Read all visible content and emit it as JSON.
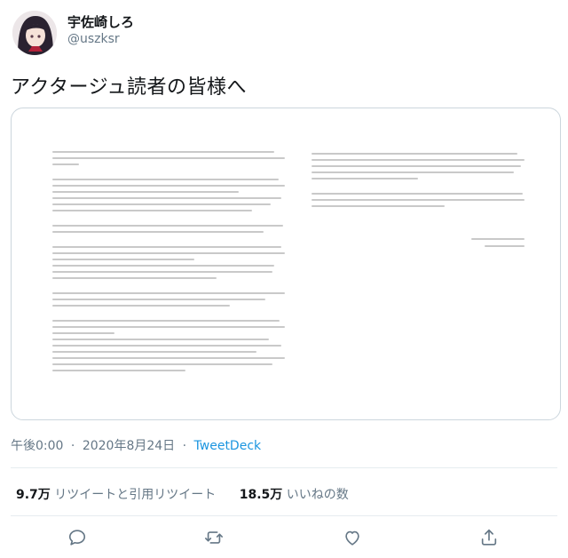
{
  "user": {
    "display_name": "宇佐崎しろ",
    "handle": "@uszksr"
  },
  "tweet": {
    "text": "アクタージュ読者の皆様へ"
  },
  "meta": {
    "time": "午後0:00",
    "separator": "·",
    "date": "2020年8月24日",
    "source": "TweetDeck"
  },
  "stats": {
    "retweets_value": "9.7万",
    "retweets_label": "リツイートと引用リツイート",
    "likes_value": "18.5万",
    "likes_label": "いいねの数"
  },
  "actions": [
    {
      "icon": "reply-icon"
    },
    {
      "icon": "retweet-icon"
    },
    {
      "icon": "like-icon"
    },
    {
      "icon": "share-icon"
    }
  ],
  "colors": {
    "text": "#14171a",
    "secondary": "#657786",
    "link": "#1b95e0",
    "border": "#ccd6dd"
  }
}
